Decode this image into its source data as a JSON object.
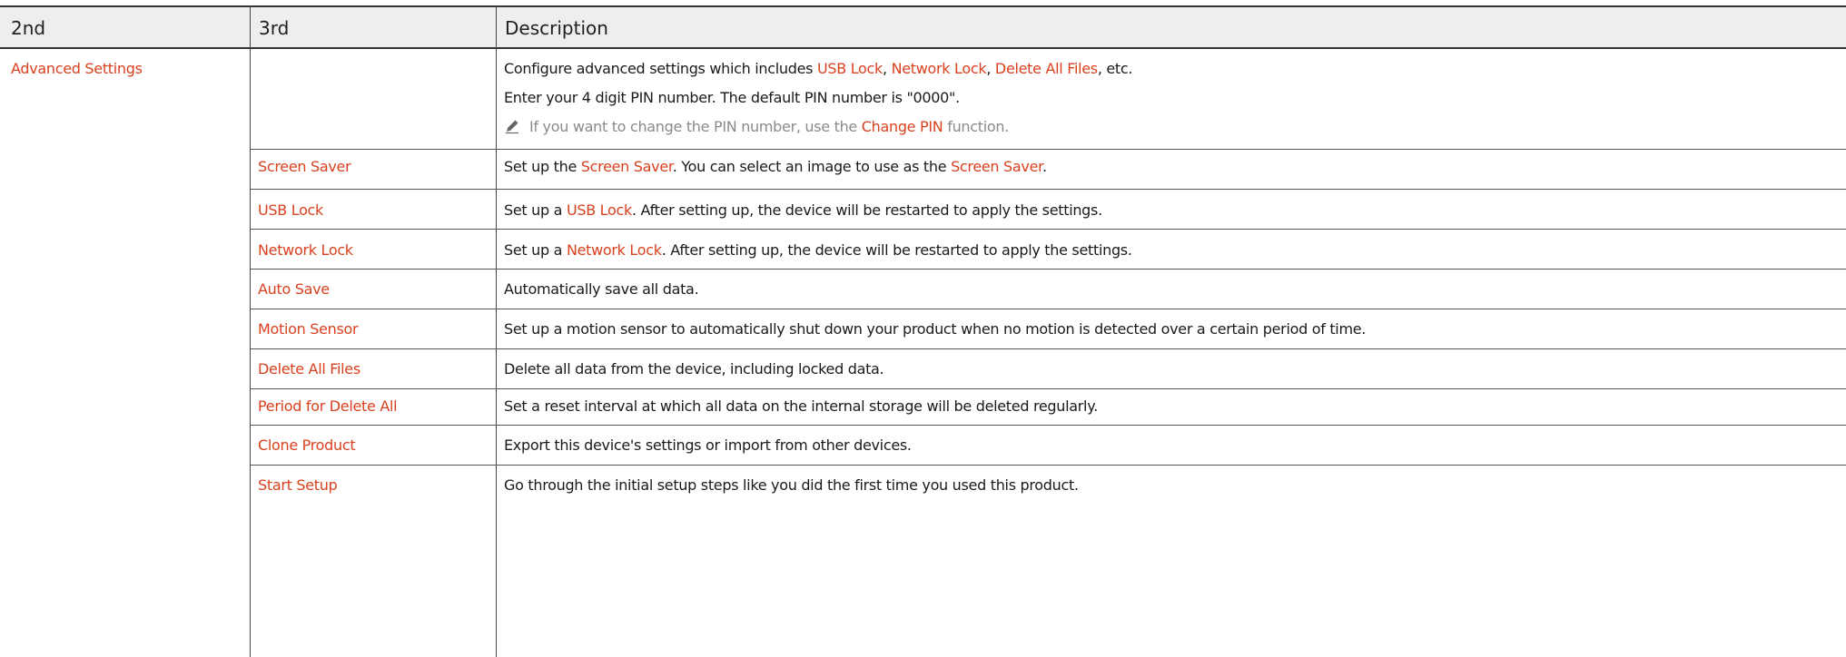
{
  "header": {
    "col1": "2nd",
    "col2": "3rd",
    "col3": "Description"
  },
  "advanced": {
    "label": "Advanced Settings",
    "desc1": {
      "t1": "Configure advanced settings which includes ",
      "h1": "USB Lock",
      "t2": ", ",
      "h2": "Network Lock",
      "t3": ", ",
      "h3": "Delete All Files",
      "t4": ", etc."
    },
    "desc2": "Enter your 4 digit PIN number. The default PIN number is \"0000\".",
    "note": {
      "icon": "pencil-icon",
      "t1": "If you want to change the PIN number, use the ",
      "h1": "Change PIN",
      "t2": " function."
    }
  },
  "rows": [
    {
      "label": "Screen Saver",
      "desc": {
        "t1": "Set up the ",
        "h1": "Screen Saver",
        "t2": ". You can select an image to use as the ",
        "h2": "Screen Saver",
        "t3": "."
      }
    },
    {
      "label": "USB Lock",
      "desc": {
        "t1": "Set up a ",
        "h1": "USB Lock",
        "t2": ". After setting up, the device will be restarted to apply the settings."
      }
    },
    {
      "label": "Network Lock",
      "desc": {
        "t1": "Set up a ",
        "h1": "Network Lock",
        "t2": ". After setting up, the device will be restarted to apply the settings."
      }
    },
    {
      "label": "Auto Save",
      "desc": {
        "t1": "Automatically save all data."
      }
    },
    {
      "label": "Motion Sensor",
      "desc": {
        "t1": "Set up a motion sensor to automatically shut down your product when no motion is detected over a certain period of time."
      }
    },
    {
      "label": "Delete All Files",
      "desc": {
        "t1": "Delete all data from the device, including locked data."
      }
    },
    {
      "label": "Period for Delete All",
      "desc": {
        "t1": "Set a reset interval at which all data on the internal storage will be deleted regularly."
      }
    },
    {
      "label": "Clone Product",
      "desc": {
        "t1": "Export this device's settings or import from other devices."
      }
    },
    {
      "label": "Start Setup",
      "desc": {
        "t1": "Go through the initial setup steps like you did the first time you used this product."
      }
    }
  ],
  "colors": {
    "highlight": "#d9411f",
    "note": "#8a8a8a",
    "header_bg": "#eeeeee"
  }
}
